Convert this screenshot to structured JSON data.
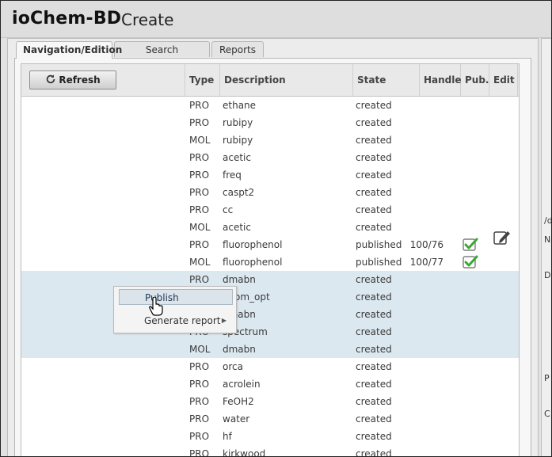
{
  "header": {
    "app_name": "ioChem-BD",
    "page_title": "Create"
  },
  "tabs": [
    {
      "label": "Navigation/Edition",
      "active": true
    },
    {
      "label": "Search Repository",
      "active": false
    },
    {
      "label": "Reports",
      "active": false
    }
  ],
  "toolbar": {
    "refresh_label": "Refresh"
  },
  "columns": {
    "type": "Type",
    "description": "Description",
    "state": "State",
    "handle": "Handle",
    "pub": "Pub.",
    "edit": "Edit"
  },
  "rows": [
    {
      "name": "ethane",
      "level": 0,
      "expander": "collapsed",
      "type": "PRO",
      "description": "ethane",
      "state": "created"
    },
    {
      "name": "rubipy",
      "level": 0,
      "expander": "expanded",
      "type": "PRO",
      "description": "rubipy",
      "state": "created"
    },
    {
      "name": "rubipy",
      "level": 1,
      "expander": "none",
      "type": "MOL",
      "description": "rubipy",
      "state": "created"
    },
    {
      "name": "acetic",
      "level": 0,
      "expander": "expanded",
      "type": "PRO",
      "description": "acetic",
      "state": "created"
    },
    {
      "name": "freq",
      "level": 1,
      "expander": "collapsed",
      "type": "PRO",
      "description": "freq",
      "state": "created"
    },
    {
      "name": "caspt2",
      "level": 1,
      "expander": "collapsed",
      "type": "PRO",
      "description": "caspt2",
      "state": "created"
    },
    {
      "name": "cc",
      "level": 1,
      "expander": "collapsed",
      "type": "PRO",
      "description": "cc",
      "state": "created"
    },
    {
      "name": "acetic",
      "level": 1,
      "expander": "none",
      "type": "MOL",
      "description": "acetic",
      "state": "created"
    },
    {
      "name": "fluorophenol",
      "level": 0,
      "expander": "expanded",
      "type": "PRO",
      "description": "fluorophenol",
      "state": "published",
      "handle": "100/76",
      "published": true
    },
    {
      "name": "fluorophenol",
      "level": 1,
      "expander": "none",
      "type": "MOL",
      "description": "fluorophenol",
      "state": "published",
      "handle": "100/77",
      "published": true
    },
    {
      "name": "dmabn",
      "level": 0,
      "expander": "expanded",
      "type": "PRO",
      "description": "dmabn",
      "state": "created",
      "selected": true
    },
    {
      "name": "geom_opt",
      "level": 1,
      "expander": "expanded",
      "type": "PRO",
      "description": "geom_opt",
      "state": "created",
      "selected": true
    },
    {
      "name": "dmabn",
      "level": 2,
      "expander": "none",
      "type": "MOL",
      "description": "dmabn",
      "state": "created",
      "selected": true
    },
    {
      "name": "spectrum",
      "level": 1,
      "expander": "expanded",
      "type": "PRO",
      "description": "spectrum",
      "state": "created",
      "selected": true
    },
    {
      "name": "dmabn",
      "level": 2,
      "expander": "none",
      "type": "MOL",
      "description": "dmabn",
      "state": "created",
      "selected": true
    },
    {
      "name": "orca",
      "level": 0,
      "expander": "collapsed",
      "type": "PRO",
      "description": "orca",
      "state": "created"
    },
    {
      "name": "acrolein",
      "level": 0,
      "expander": "collapsed",
      "type": "PRO",
      "description": "acrolein",
      "state": "created"
    },
    {
      "name": "FeOH2",
      "level": 0,
      "expander": "collapsed",
      "type": "PRO",
      "description": "FeOH2",
      "state": "created"
    },
    {
      "name": "water",
      "level": 0,
      "expander": "collapsed",
      "type": "PRO",
      "description": "water",
      "state": "created"
    },
    {
      "name": "hf",
      "level": 0,
      "expander": "collapsed",
      "type": "PRO",
      "description": "hf",
      "state": "created"
    },
    {
      "name": "kirkwood",
      "level": 0,
      "expander": "collapsed",
      "type": "PRO",
      "description": "kirkwood",
      "state": "created"
    }
  ],
  "context_menu": {
    "items": [
      {
        "label": "Publish",
        "hover": true
      },
      {
        "label": "Generate report",
        "submenu": true
      }
    ]
  },
  "right_panel": {
    "labels": [
      "/d",
      "N",
      "D",
      "P",
      "C"
    ]
  },
  "colors": {
    "selection": "#dce8ef",
    "check": "#3aa832",
    "scrollbar": "#646464"
  },
  "icons": {
    "refresh": "refresh-icon",
    "publish": "check-icon",
    "edit": "edit-icon",
    "cursor": "hand-cursor-icon"
  }
}
